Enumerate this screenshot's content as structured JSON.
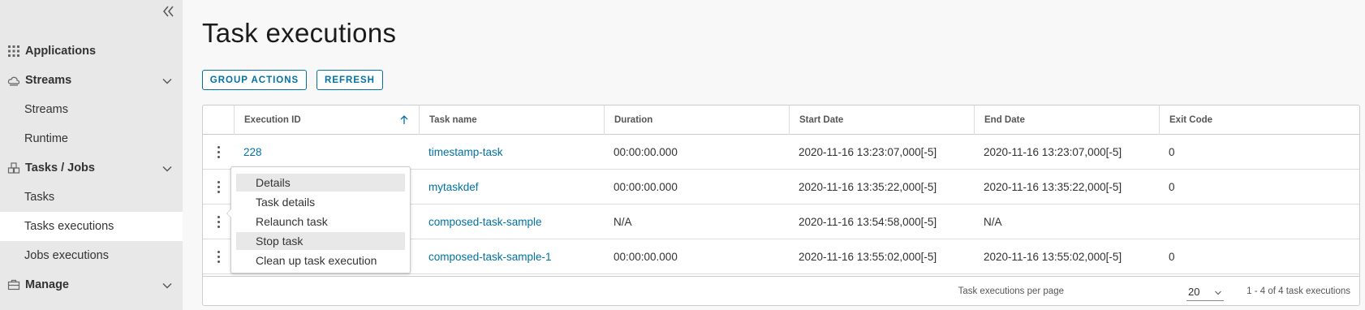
{
  "sidebar": {
    "collapse_icon": "double-chevron-left-icon",
    "items": [
      {
        "label": "Applications",
        "icon": "grid-icon"
      },
      {
        "label": "Streams",
        "icon": "cloud-icon"
      },
      {
        "label": "Streams"
      },
      {
        "label": "Runtime"
      },
      {
        "label": "Tasks / Jobs",
        "icon": "stack-icon"
      },
      {
        "label": "Tasks"
      },
      {
        "label": "Tasks executions"
      },
      {
        "label": "Jobs executions"
      },
      {
        "label": "Manage",
        "icon": "briefcase-icon"
      }
    ]
  },
  "page": {
    "title": "Task executions",
    "group_actions_label": "GROUP ACTIONS",
    "refresh_label": "REFRESH"
  },
  "table": {
    "columns": [
      "Execution ID",
      "Task name",
      "Duration",
      "Start Date",
      "End Date",
      "Exit Code"
    ],
    "rows": [
      {
        "id": "228",
        "task": "timestamp-task",
        "duration": "00:00:00.000",
        "start": "2020-11-16 13:23:07,000[-5]",
        "end": "2020-11-16 13:23:07,000[-5]",
        "exit": "0"
      },
      {
        "id": "",
        "task": "mytaskdef",
        "duration": "00:00:00.000",
        "start": "2020-11-16 13:35:22,000[-5]",
        "end": "2020-11-16 13:35:22,000[-5]",
        "exit": "0"
      },
      {
        "id": "",
        "task": "composed-task-sample",
        "duration": "N/A",
        "start": "2020-11-16 13:54:58,000[-5]",
        "end": "N/A",
        "exit": ""
      },
      {
        "id": "",
        "task": "composed-task-sample-1",
        "duration": "00:00:00.000",
        "start": "2020-11-16 13:55:02,000[-5]",
        "end": "2020-11-16 13:55:02,000[-5]",
        "exit": "0"
      }
    ],
    "footer": {
      "per_page_label": "Task executions per page",
      "page_size": "20",
      "count_text": "1 - 4 of 4 task executions"
    }
  },
  "menu": {
    "items": [
      "Details",
      "Task details",
      "Relaunch task",
      "Stop task",
      "Clean up task execution"
    ]
  },
  "colors": {
    "accent": "#0072a3",
    "sidebar_bg": "#e8e8e8",
    "page_bg": "#f8f8f8"
  }
}
